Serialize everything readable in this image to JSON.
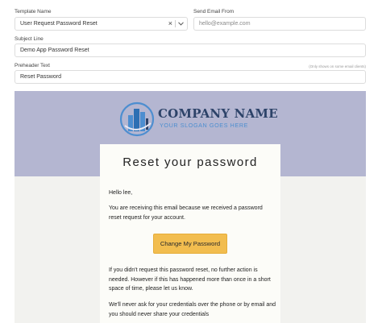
{
  "form": {
    "template_name": {
      "label": "Template Name",
      "value": "User Request Password Reset"
    },
    "send_email_from": {
      "label": "Send Email From",
      "placeholder": "hello@example.com"
    },
    "subject_line": {
      "label": "Subject Line",
      "value": "Demo App Password Reset"
    },
    "preheader_text": {
      "label": "Preheader Text",
      "hint": "(Only shows on some email clients)",
      "value": "Reset Password"
    }
  },
  "preview": {
    "company_name": "COMPANY NAME",
    "slogan": "YOUR SLOGAN GOES HERE",
    "title": "Reset your password",
    "greeting": "Hello lee,",
    "intro": "You are receiving this email because we received a password reset request for your account.",
    "button_label": "Change My Password",
    "notice": "If you didn't request this password reset, no further action is needed. However if this has happened more than once in a short space of time, please let us know.",
    "security_note": "We'll never ask for your credentials over the phone or by email and you should never share your credentials"
  },
  "colors": {
    "header_bg": "#b4b6d1",
    "company_name": "#2d4369",
    "slogan": "#4d8ed0",
    "button_bg": "#f2bd4f"
  }
}
